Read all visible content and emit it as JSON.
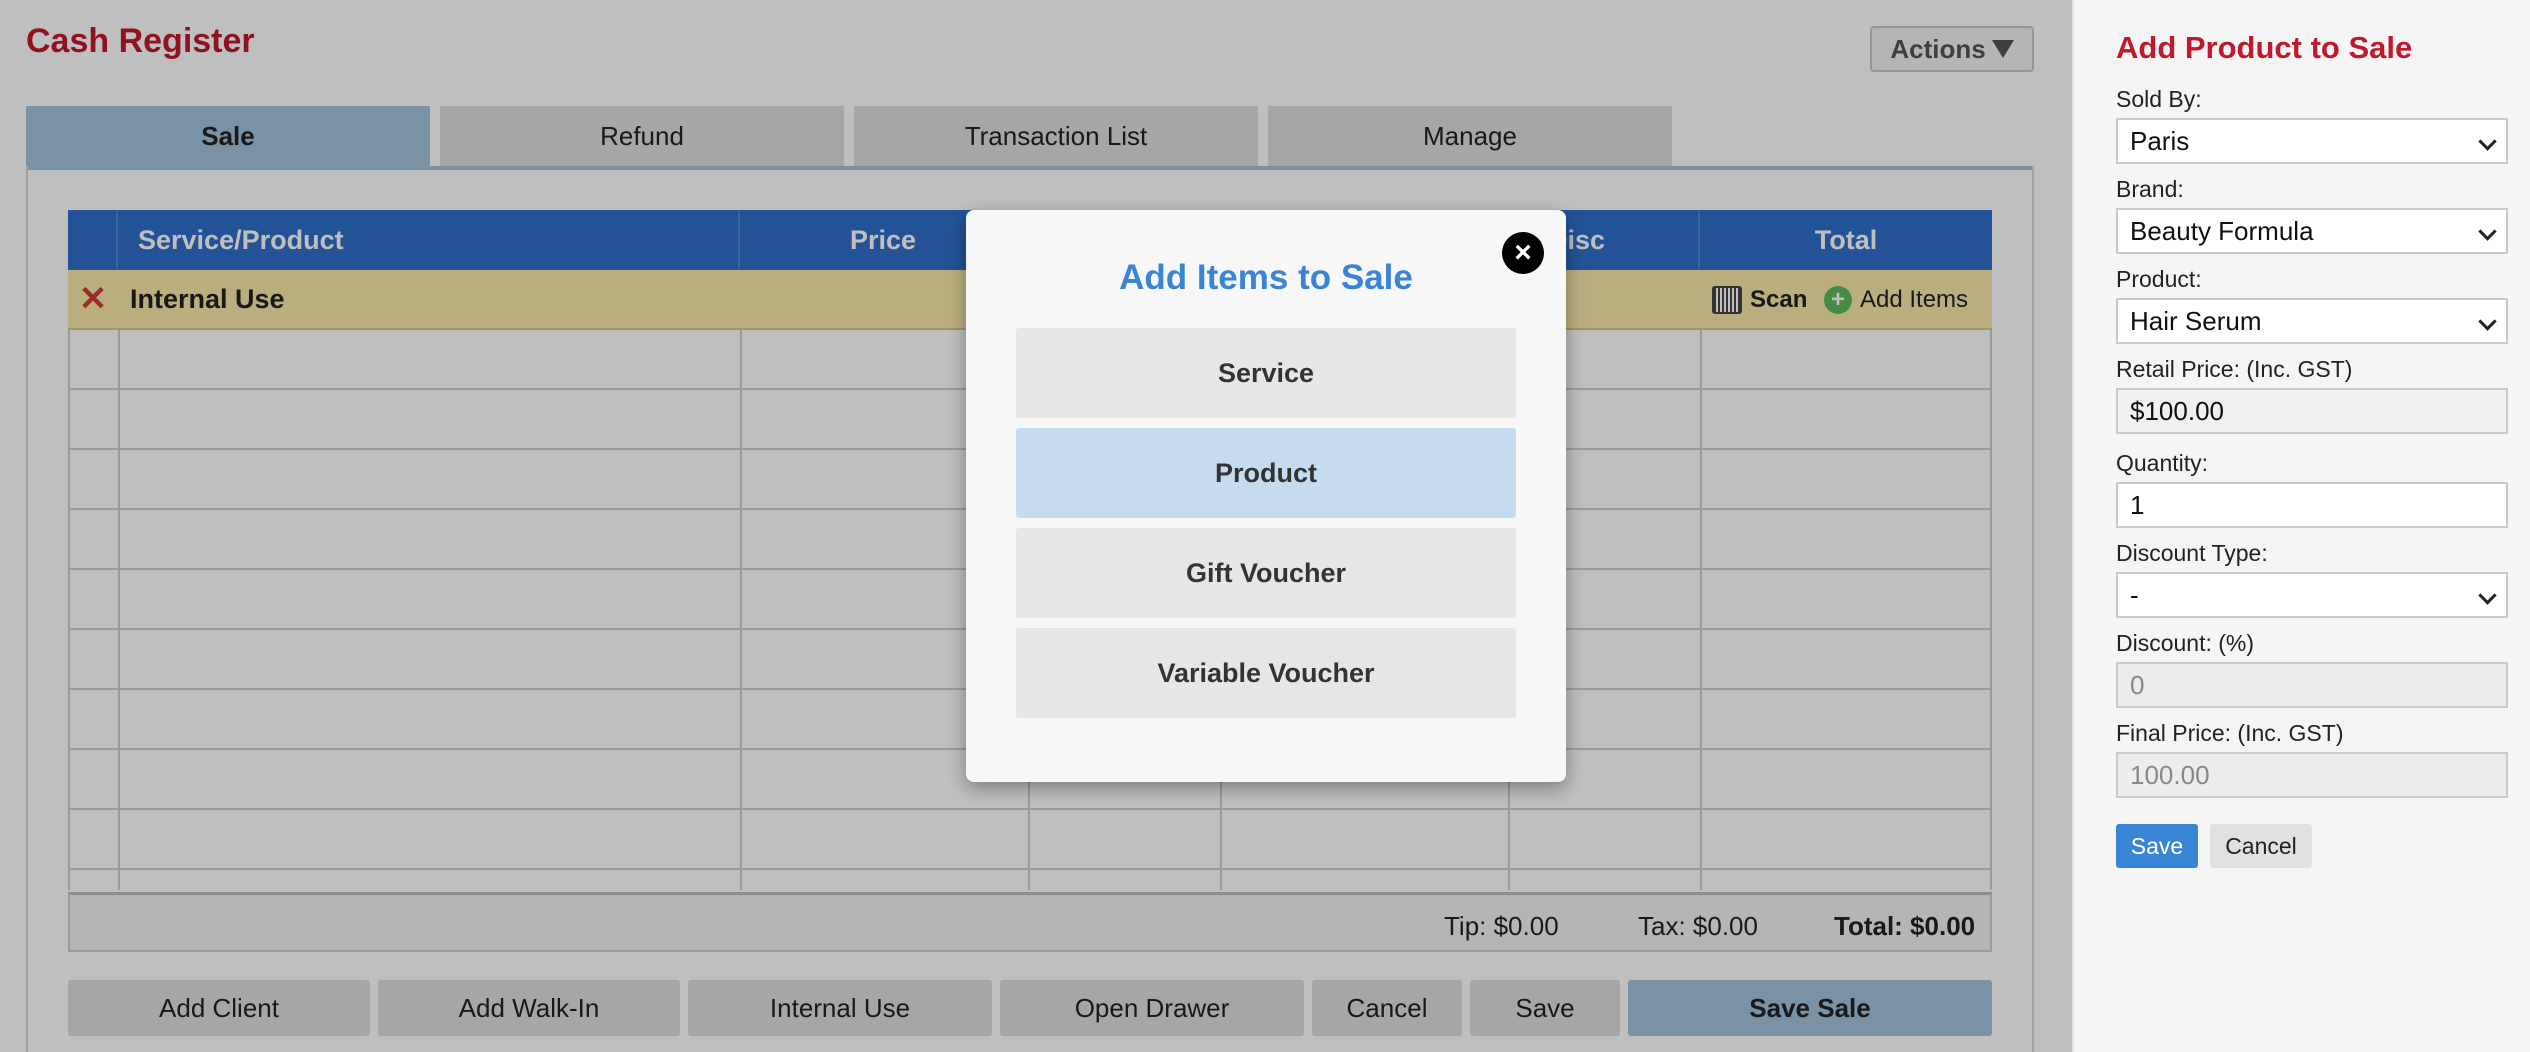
{
  "main": {
    "title": "Cash Register",
    "actions_label": "Actions",
    "tabs": [
      {
        "label": "Sale",
        "active": true
      },
      {
        "label": "Refund"
      },
      {
        "label": "Transaction List"
      },
      {
        "label": "Manage"
      }
    ]
  },
  "table": {
    "headers": {
      "service_product": "Service/Product",
      "price": "Price",
      "disc": "Disc",
      "total": "Total"
    },
    "group_row": {
      "label": "Internal Use",
      "scan_label": "Scan",
      "add_items_label": "Add Items"
    },
    "totals": {
      "tip": "Tip: $0.00",
      "tax": "Tax: $0.00",
      "total": "Total: $0.00"
    }
  },
  "bottom_buttons": {
    "add_client": "Add Client",
    "add_walkin": "Add Walk-In",
    "internal_use": "Internal Use",
    "open_drawer": "Open Drawer",
    "cancel": "Cancel",
    "save": "Save",
    "save_sale": "Save Sale"
  },
  "modal": {
    "title": "Add Items to Sale",
    "close_icon": "×",
    "options": [
      "Service",
      "Product",
      "Gift Voucher",
      "Variable Voucher"
    ],
    "highlighted": "Product"
  },
  "side_panel": {
    "title": "Add Product to Sale",
    "sold_by": {
      "label": "Sold By:",
      "value": "Paris"
    },
    "brand": {
      "label": "Brand:",
      "value": "Beauty Formula"
    },
    "product": {
      "label": "Product:",
      "value": "Hair Serum"
    },
    "retail_price": {
      "label": "Retail Price: (Inc. GST)",
      "value": "$100.00"
    },
    "quantity": {
      "label": "Quantity:",
      "value": "1"
    },
    "discount_type": {
      "label": "Discount Type:",
      "value": "-"
    },
    "discount": {
      "label": "Discount: (%)",
      "value": "0"
    },
    "final_price": {
      "label": "Final Price: (Inc. GST)",
      "value": "100.00"
    },
    "save_label": "Save",
    "cancel_label": "Cancel"
  },
  "colors": {
    "brand_red": "#c0182c",
    "header_blue": "#2f6fc8",
    "accent_blue": "#3a84d6",
    "highlight_row": "#fae8a8"
  }
}
